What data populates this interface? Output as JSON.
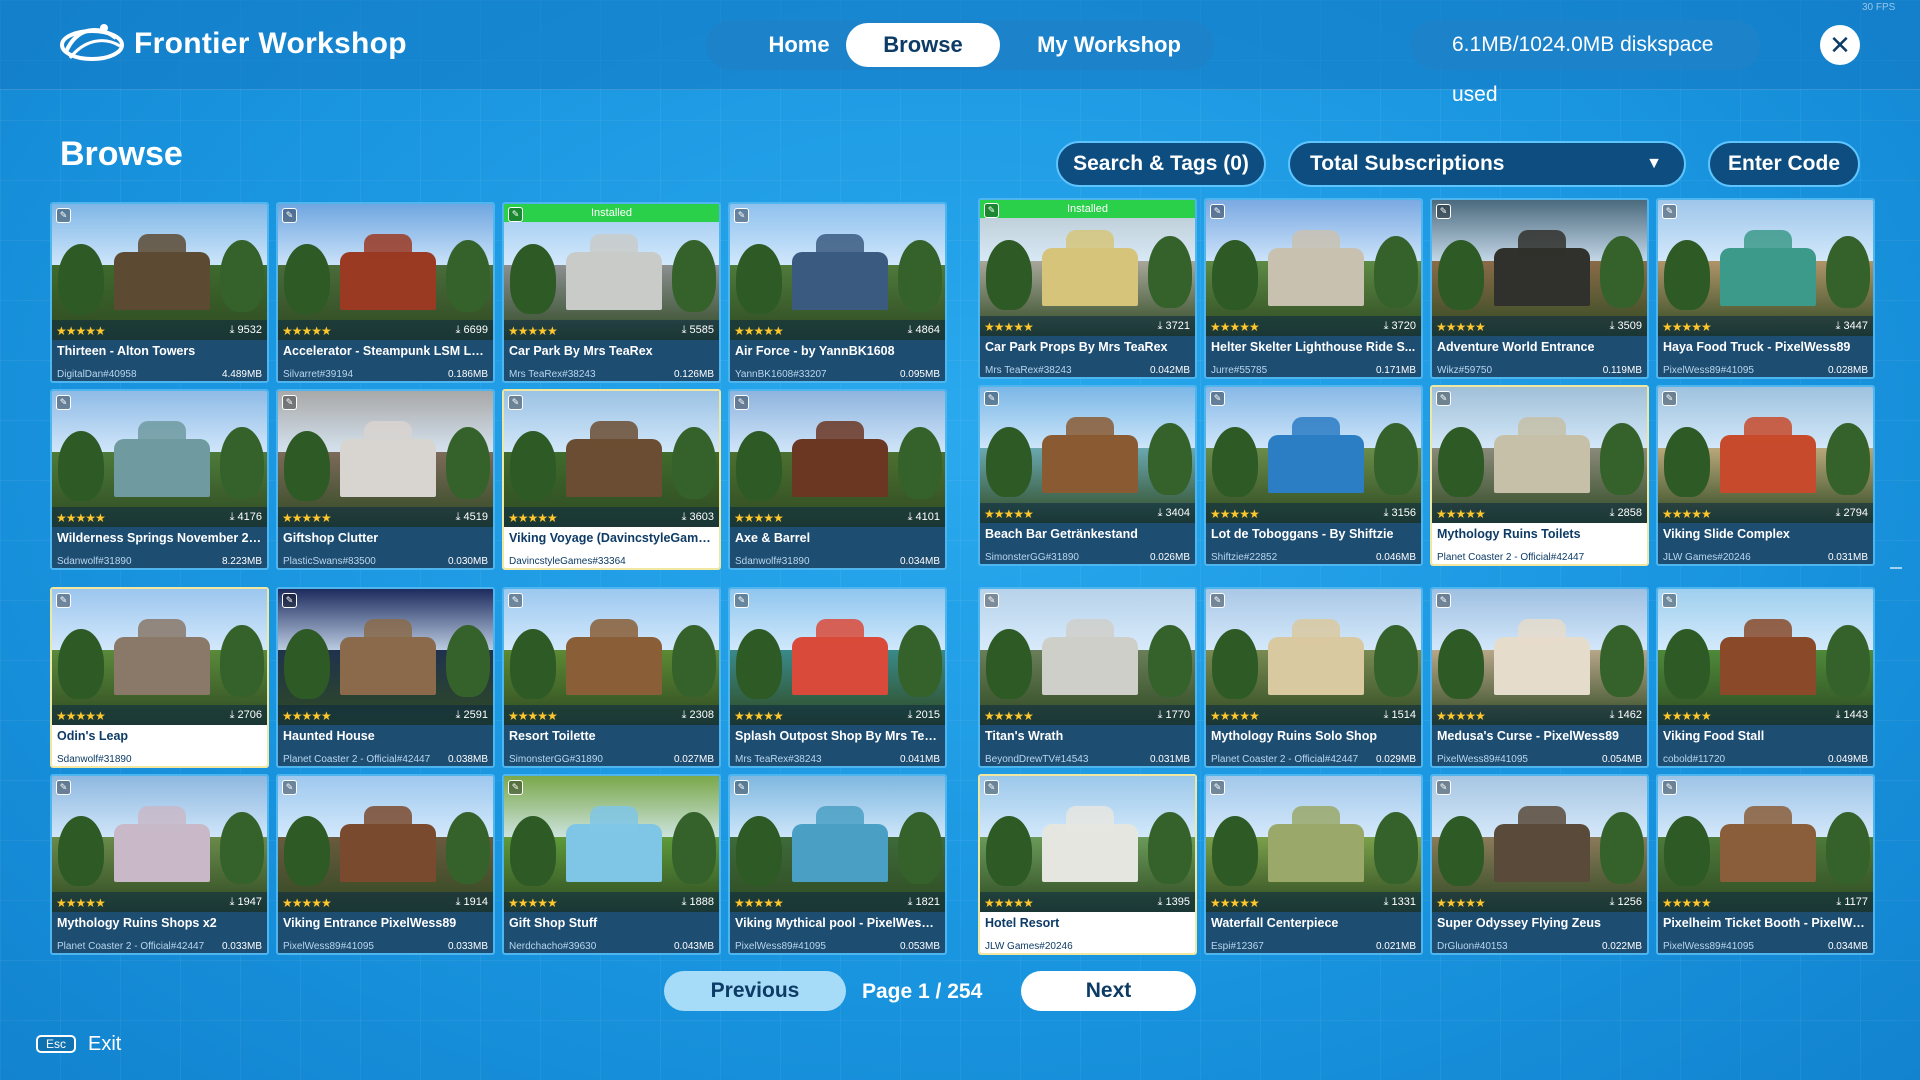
{
  "app": {
    "title": "Frontier Workshop",
    "fps": "30 FPS"
  },
  "nav": {
    "tabs": [
      {
        "label": "Home"
      },
      {
        "label": "Browse"
      },
      {
        "label": "My Workshop"
      }
    ],
    "active": "Browse"
  },
  "disk": {
    "text": "6.1MB/1024.0MB diskspace used"
  },
  "page": {
    "title": "Browse"
  },
  "toolbar": {
    "search_label": "Search & Tags (0)",
    "sort_label": "Total Subscriptions",
    "enter_code_label": "Enter Code"
  },
  "items": [
    {
      "name": "Thirteen - Alton Towers",
      "author": "DigitalDan#40958",
      "size": "4.489MB",
      "downloads": "9532",
      "rating": 5,
      "installed": false
    },
    {
      "name": "Accelerator - Steampunk LSM La...",
      "author": "Silvarret#39194",
      "size": "0.186MB",
      "downloads": "6699",
      "rating": 5,
      "installed": false
    },
    {
      "name": "Car Park By Mrs TeaRex",
      "author": "Mrs TeaRex#38243",
      "size": "0.126MB",
      "downloads": "5585",
      "rating": 5,
      "installed": true
    },
    {
      "name": "Air Force - by YannBK1608",
      "author": "YannBK1608#33207",
      "size": "0.095MB",
      "downloads": "4864",
      "rating": 5,
      "installed": false
    },
    {
      "name": "Car Park Props By Mrs TeaRex",
      "author": "Mrs TeaRex#38243",
      "size": "0.042MB",
      "downloads": "3721",
      "rating": 5,
      "installed": true
    },
    {
      "name": "Helter Skelter Lighthouse Ride S...",
      "author": "Jurre#55785",
      "size": "0.171MB",
      "downloads": "3720",
      "rating": 5,
      "installed": false
    },
    {
      "name": "Adventure World Entrance",
      "author": "Wikz#59750",
      "size": "0.119MB",
      "downloads": "3509",
      "rating": 5,
      "installed": false
    },
    {
      "name": "Haya Food Truck - PixelWess89",
      "author": "PixelWess89#41095",
      "size": "0.028MB",
      "downloads": "3447",
      "rating": 5,
      "installed": false
    },
    {
      "name": "Wilderness Springs November 20...",
      "author": "Sdanwolf#31890",
      "size": "8.223MB",
      "downloads": "4176",
      "rating": 5,
      "installed": false
    },
    {
      "name": "Giftshop Clutter",
      "author": "PlasticSwans#83500",
      "size": "0.030MB",
      "downloads": "4519",
      "rating": 5,
      "installed": false
    },
    {
      "name": "Viking Voyage (DavincstyleGames)",
      "author": "DavincstyleGames#33364",
      "size": "",
      "downloads": "3603",
      "rating": 5,
      "installed": false,
      "selected": true
    },
    {
      "name": "Axe & Barrel",
      "author": "Sdanwolf#31890",
      "size": "0.034MB",
      "downloads": "4101",
      "rating": 5,
      "installed": false
    },
    {
      "name": "Beach Bar Getränkestand",
      "author": "SimonsterGG#31890",
      "size": "0.026MB",
      "downloads": "3404",
      "rating": 5,
      "installed": false
    },
    {
      "name": "Lot de Toboggans - By Shiftzie",
      "author": "Shiftzie#22852",
      "size": "0.046MB",
      "downloads": "3156",
      "rating": 5,
      "installed": false
    },
    {
      "name": "Mythology Ruins Toilets",
      "author": "Planet Coaster 2 - Official#42447",
      "size": "",
      "downloads": "2858",
      "rating": 5,
      "installed": false,
      "selected": true
    },
    {
      "name": "Viking Slide Complex",
      "author": "JLW Games#20246",
      "size": "0.031MB",
      "downloads": "2794",
      "rating": 5,
      "installed": false
    },
    {
      "name": "Odin's Leap",
      "author": "Sdanwolf#31890",
      "size": "",
      "downloads": "2706",
      "rating": 5,
      "installed": false,
      "selected": true
    },
    {
      "name": "Haunted House",
      "author": "Planet Coaster 2 - Official#42447",
      "size": "0.038MB",
      "downloads": "2591",
      "rating": 5,
      "installed": false
    },
    {
      "name": "Resort Toilette",
      "author": "SimonsterGG#31890",
      "size": "0.027MB",
      "downloads": "2308",
      "rating": 5,
      "installed": false
    },
    {
      "name": "Splash Outpost Shop By Mrs Tea...",
      "author": "Mrs TeaRex#38243",
      "size": "0.041MB",
      "downloads": "2015",
      "rating": 5,
      "installed": false
    },
    {
      "name": "Titan's Wrath",
      "author": "BeyondDrewTV#14543",
      "size": "0.031MB",
      "downloads": "1770",
      "rating": 5,
      "installed": false
    },
    {
      "name": "Mythology Ruins Solo Shop",
      "author": "Planet Coaster 2 - Official#42447",
      "size": "0.029MB",
      "downloads": "1514",
      "rating": 5,
      "installed": false
    },
    {
      "name": "Medusa's Curse - PixelWess89",
      "author": "PixelWess89#41095",
      "size": "0.054MB",
      "downloads": "1462",
      "rating": 5,
      "installed": false
    },
    {
      "name": "Viking Food Stall",
      "author": "cobold#11720",
      "size": "0.049MB",
      "downloads": "1443",
      "rating": 5,
      "installed": false
    },
    {
      "name": "Mythology Ruins Shops x2",
      "author": "Planet Coaster 2 - Official#42447",
      "size": "0.033MB",
      "downloads": "1947",
      "rating": 5,
      "installed": false
    },
    {
      "name": "Viking Entrance PixelWess89",
      "author": "PixelWess89#41095",
      "size": "0.033MB",
      "downloads": "1914",
      "rating": 5,
      "installed": false
    },
    {
      "name": "Gift Shop Stuff",
      "author": "Nerdchacho#39630",
      "size": "0.043MB",
      "downloads": "1888",
      "rating": 5,
      "installed": false
    },
    {
      "name": "Viking Mythical pool - PixelWess89",
      "author": "PixelWess89#41095",
      "size": "0.053MB",
      "downloads": "1821",
      "rating": 5,
      "installed": false
    },
    {
      "name": "Hotel Resort",
      "author": "JLW Games#20246",
      "size": "",
      "downloads": "1395",
      "rating": 5,
      "installed": false,
      "selected": true
    },
    {
      "name": "Waterfall Centerpiece",
      "author": "Espi#12367",
      "size": "0.021MB",
      "downloads": "1331",
      "rating": 5,
      "installed": false
    },
    {
      "name": "Super Odyssey Flying Zeus",
      "author": "DrGluon#40153",
      "size": "0.022MB",
      "downloads": "1256",
      "rating": 5,
      "installed": false
    },
    {
      "name": "Pixelheim Ticket Booth - PixelWe...",
      "author": "PixelWess89#41095",
      "size": "0.034MB",
      "downloads": "1177",
      "rating": 5,
      "installed": false
    }
  ],
  "installed_label": "Installed",
  "pagination": {
    "previous_label": "Previous",
    "page_text": "Page 1 / 254",
    "next_label": "Next"
  },
  "footer": {
    "key": "Esc",
    "label": "Exit"
  },
  "colors": {
    "accent": "#1a96e0",
    "installed": "#2ad04a",
    "star": "#ffc72c",
    "panel": "#0e4d7f"
  }
}
